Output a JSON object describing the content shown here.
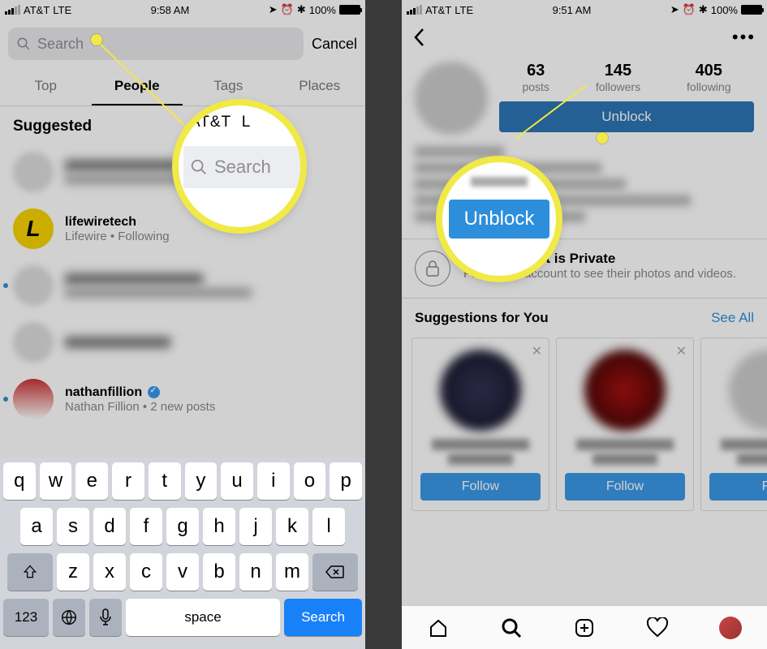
{
  "left": {
    "status": {
      "carrier": "AT&T",
      "network": "LTE",
      "time": "9:58 AM",
      "battery": "100%"
    },
    "search": {
      "placeholder": "Search",
      "cancel": "Cancel"
    },
    "tabs": [
      "Top",
      "People",
      "Tags",
      "Places"
    ],
    "active_tab": "People",
    "suggested_header": "Suggested",
    "suggested": [
      {
        "name": "",
        "sub": "",
        "blurred": true
      },
      {
        "name": "lifewiretech",
        "sub": "Lifewire • Following",
        "avatar_letter": "L"
      },
      {
        "name": "",
        "sub": "",
        "blurred": true,
        "dot": true
      },
      {
        "name": "",
        "sub": "",
        "blurred": true
      },
      {
        "name": "nathanfillion",
        "sub": "Nathan Fillion • 2 new posts",
        "verified": true,
        "dot": true
      }
    ],
    "keyboard": {
      "r1": [
        "q",
        "w",
        "e",
        "r",
        "t",
        "y",
        "u",
        "i",
        "o",
        "p"
      ],
      "r2": [
        "a",
        "s",
        "d",
        "f",
        "g",
        "h",
        "j",
        "k",
        "l"
      ],
      "r3": [
        "z",
        "x",
        "c",
        "v",
        "b",
        "n",
        "m"
      ],
      "numkey": "123",
      "space": "space",
      "search": "Search"
    },
    "callout": {
      "carrier": "AT&T",
      "network_partial": "L",
      "placeholder": "Search"
    }
  },
  "right": {
    "status": {
      "carrier": "AT&T",
      "network": "LTE",
      "time": "9:51 AM",
      "battery": "100%"
    },
    "stats": {
      "posts_n": "63",
      "posts_l": "posts",
      "followers_n": "145",
      "followers_l": "followers",
      "following_n": "405",
      "following_l": "following"
    },
    "unblock": "Unblock",
    "private": {
      "title": "This Account is Private",
      "sub": "Follow this account to see their photos and videos."
    },
    "suggestions_header": "Suggestions for You",
    "see_all": "See All",
    "follow": "Follow",
    "follow_partial": "Fo",
    "callout_unblock": "Unblock"
  }
}
